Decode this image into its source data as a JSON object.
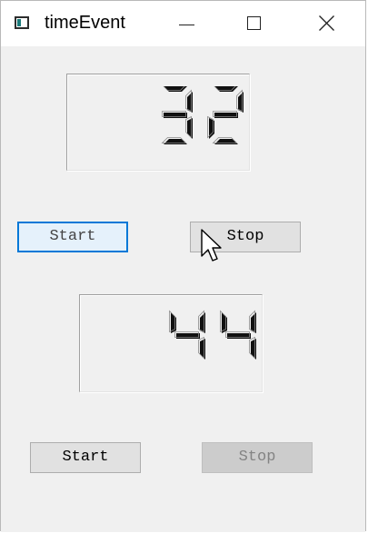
{
  "window": {
    "title": "timeEvent",
    "controls": {
      "minimize_icon": "minimize-icon",
      "maximize_icon": "maximize-icon",
      "close_icon": "close-icon"
    }
  },
  "timer1": {
    "display_value": "32",
    "start_label": "Start",
    "stop_label": "Stop",
    "start_state": "focused",
    "stop_state": "enabled"
  },
  "timer2": {
    "display_value": "44",
    "start_label": "Start",
    "stop_label": "Stop",
    "start_state": "enabled",
    "stop_state": "disabled"
  },
  "cursor": {
    "icon": "mouse-pointer-icon"
  },
  "colors": {
    "focus_border": "#0078d7",
    "focus_fill": "#e5f1fb",
    "button_fill": "#e1e1e1",
    "disabled_text": "#838383",
    "client_bg": "#f0f0f0"
  }
}
